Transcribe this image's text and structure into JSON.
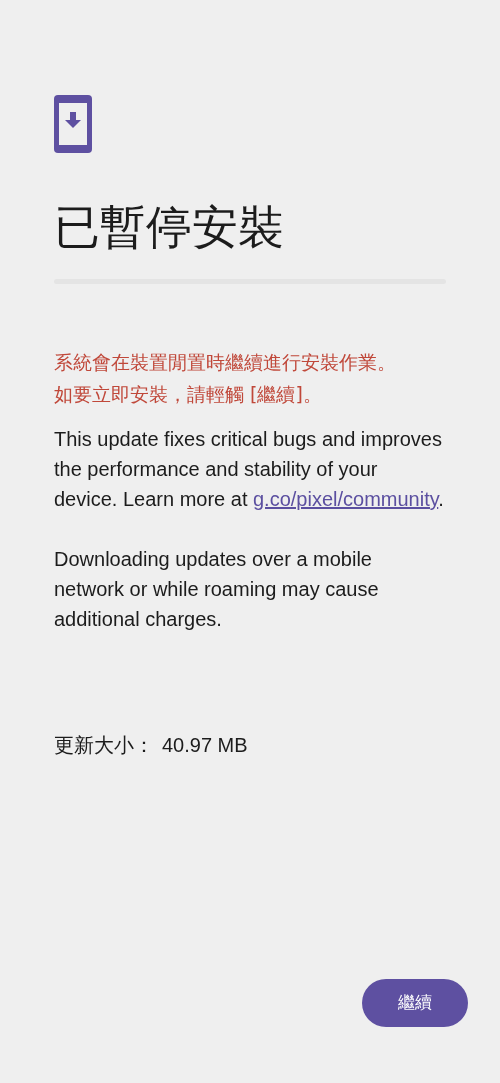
{
  "header": {
    "title": "已暫停安裝"
  },
  "notice_lines": [
    "系統會在裝置閒置時繼續進行安裝作業。",
    "如要立即安裝，請輕觸 [繼續]。"
  ],
  "details": {
    "text": "This update fixes critical bugs and improves the performance and stability of your device. Learn more at ",
    "link": "g.co/pixel/community",
    "after": "."
  },
  "warning": "Downloading updates over a mobile network or while roaming may cause additional charges.",
  "update_size": {
    "label": "更新大小：",
    "value": "40.97 MB"
  },
  "buttons": [
    {
      "label": "繼續",
      "kind": "primary"
    }
  ]
}
